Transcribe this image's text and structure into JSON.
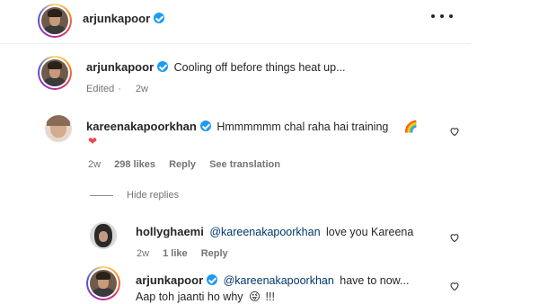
{
  "post": {
    "username": "arjunkapoor",
    "more_label": "More options"
  },
  "caption": {
    "username": "arjunkapoor",
    "text": "Cooling off before things heat up...",
    "edited": "Edited",
    "time": "2w"
  },
  "comments": [
    {
      "username": "kareenakapoorkhan",
      "text": "Hmmmmmm chal raha hai training",
      "emoji_rainbow": "🌈",
      "emoji_heart": "❤",
      "time": "2w",
      "likes": "298 likes",
      "reply": "Reply",
      "see_translation": "See translation"
    }
  ],
  "hide_replies": "Hide replies",
  "replies": [
    {
      "username": "hollyghaemi",
      "mention": "@kareenakapoorkhan",
      "text": "love you Kareena",
      "time": "2w",
      "likes": "1 like",
      "reply": "Reply"
    },
    {
      "username": "arjunkapoor",
      "mention": "@kareenakapoorkhan",
      "text": "have to now...",
      "text2": "Aap toh jaanti ho why",
      "emoji": "😜",
      "text3": "!!!"
    }
  ],
  "colors": {
    "verified": "#1d9bf0",
    "meta": "#737373",
    "mention": "#00376b",
    "heart_red": "#ed4956"
  }
}
